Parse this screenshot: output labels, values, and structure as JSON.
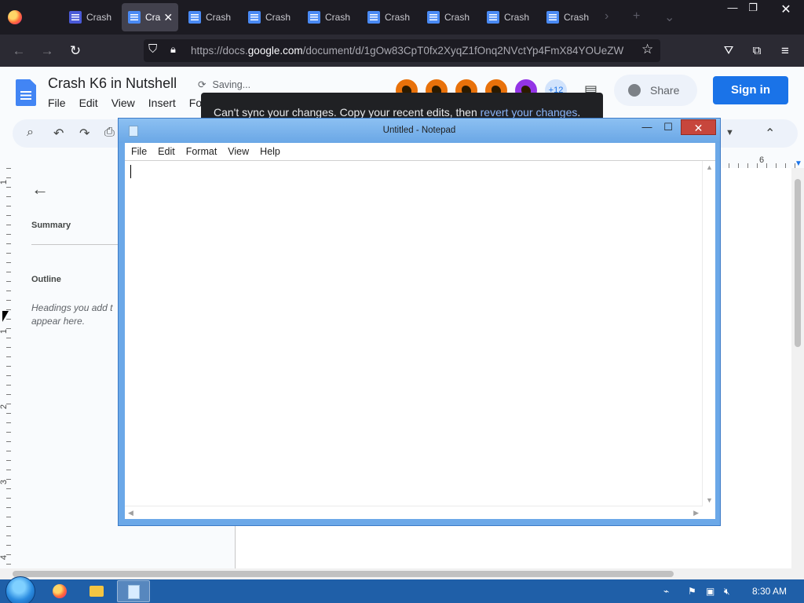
{
  "browser": {
    "tabs": [
      {
        "label": "Crash",
        "icon": "forms-icon",
        "active": false
      },
      {
        "label": "Cra",
        "icon": "doc-icon",
        "active": true
      },
      {
        "label": "Crash",
        "icon": "doc-icon",
        "active": false
      },
      {
        "label": "Crash",
        "icon": "doc-icon",
        "active": false
      },
      {
        "label": "Crash",
        "icon": "doc-icon",
        "active": false
      },
      {
        "label": "Crash",
        "icon": "doc-icon",
        "active": false
      },
      {
        "label": "Crash",
        "icon": "doc-icon",
        "active": false
      },
      {
        "label": "Crash",
        "icon": "doc-icon",
        "active": false
      },
      {
        "label": "Crash",
        "icon": "doc-icon",
        "active": false
      }
    ],
    "url_prefix": "https://docs.",
    "url_domain": "google.com",
    "url_suffix": "/document/d/1gOw83CpT0fx2XyqZ1fOnq2NVctYp4FmX84YOUeZW"
  },
  "docs": {
    "title": "Crash K6 in Nutshell",
    "save_status": "Saving...",
    "menu": [
      "File",
      "Edit",
      "View",
      "Insert",
      "Fo"
    ],
    "avatars_more": "+12",
    "share_label": "Share",
    "signin_label": "Sign in",
    "toast_text": "Can't sync your changes. Copy your recent edits, then ",
    "toast_link": "revert your changes",
    "toast_end": ".",
    "ruler_top_number": "6",
    "ruler_left_numbers": [
      "1",
      "1",
      "2",
      "3",
      "4"
    ],
    "outline": {
      "summary_heading": "Summary",
      "outline_heading": "Outline",
      "empty_text": "Headings you add t appear here."
    }
  },
  "notepad": {
    "title": "Untitled - Notepad",
    "menu": [
      "File",
      "Edit",
      "Format",
      "View",
      "Help"
    ],
    "content": ""
  },
  "taskbar": {
    "clock": "8:30 AM"
  },
  "colors": {
    "docs_blue": "#1a73e8",
    "firefox_tabbar": "#1c1b22",
    "notepad_frame": "#6ba8e8",
    "close_red": "#c7463c",
    "taskbar": "#1f5fa8"
  }
}
